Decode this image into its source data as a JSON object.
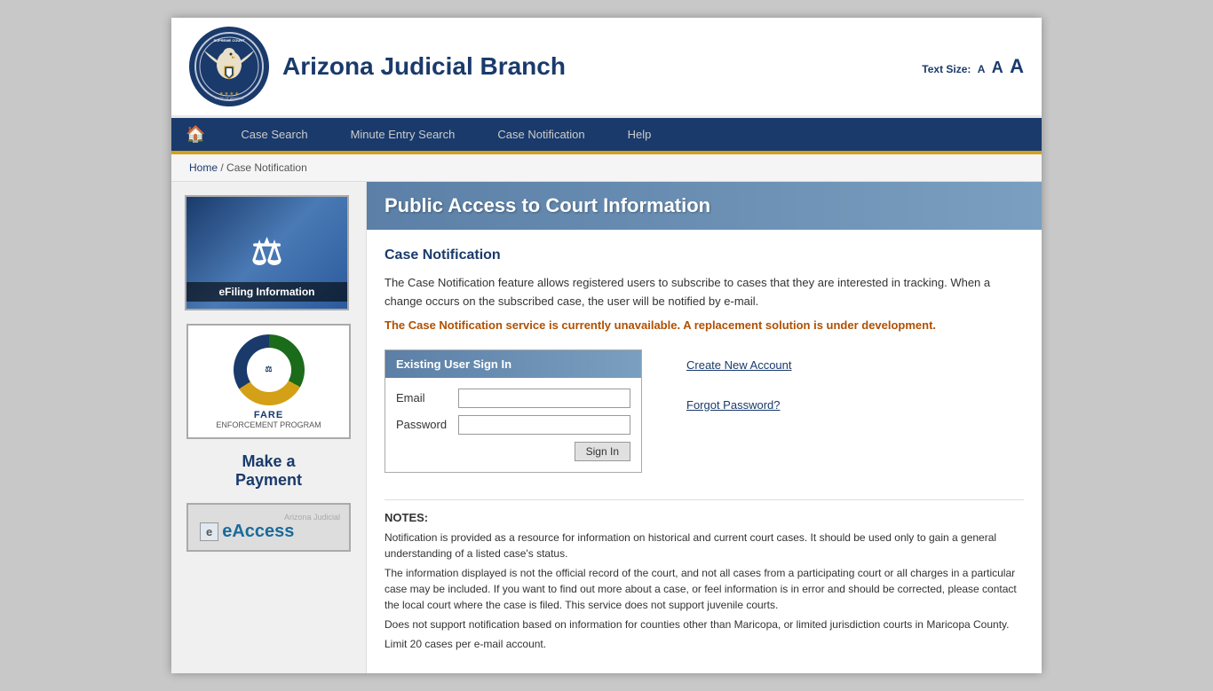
{
  "header": {
    "title": "Arizona Judicial Branch",
    "text_size_label": "Text Size:",
    "text_size_a_small": "A",
    "text_size_a_medium": "A",
    "text_size_a_large": "A"
  },
  "nav": {
    "home_icon": "🏠",
    "items": [
      {
        "id": "case-search",
        "label": "Case Search"
      },
      {
        "id": "minute-entry-search",
        "label": "Minute Entry Search"
      },
      {
        "id": "case-notification",
        "label": "Case Notification"
      },
      {
        "id": "help",
        "label": "Help"
      }
    ]
  },
  "breadcrumb": {
    "home": "Home",
    "separator": "/",
    "current": "Case Notification"
  },
  "page_header": "Public Access to Court Information",
  "content": {
    "section_title": "Case Notification",
    "info1": "The Case Notification feature allows registered users to subscribe to cases that they are interested in tracking. When a change occurs on the subscribed case, the user will be notified by e-mail.",
    "warning": "The Case Notification service is currently unavailable. A replacement solution is under development.",
    "signin_box": {
      "header": "Existing User Sign In",
      "email_label": "Email",
      "password_label": "Password",
      "signin_button": "Sign In",
      "email_placeholder": "",
      "password_placeholder": ""
    },
    "create_account_link": "Create New Account",
    "forgot_password_link": "Forgot Password?",
    "notes_title": "NOTES:",
    "notes": [
      "Notification is provided as a resource for information on historical and current court cases. It should be used only to gain a general understanding of a listed case's status.",
      "The information displayed is not the official record of the court, and not all cases from a participating court or all charges in a particular case may be included. If you want to find out more about a case, or feel information is in error and should be corrected, please contact the local court where the case is filed. This service does not support juvenile courts.",
      "Does not support notification based on information for counties other than Maricopa, or limited jurisdiction courts in Maricopa County.",
      "Limit 20 cases per e-mail account."
    ]
  },
  "sidebar": {
    "efiling_label": "eFiling Information",
    "fare_label": "FARE",
    "fare_sub": "ENFORCEMENT PROGRAM",
    "make_payment": "Make a\nPayment",
    "eaccess_label": "eAccess"
  }
}
